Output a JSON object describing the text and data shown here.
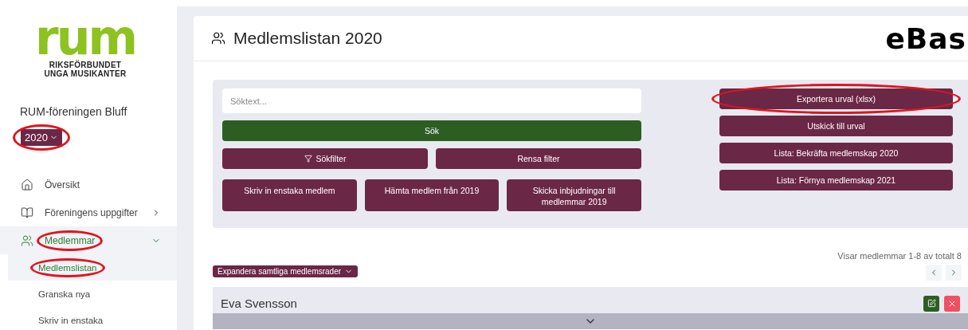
{
  "sidebar": {
    "logo_text": "rum",
    "logo_lines": [
      "RIKSFÖRBUNDET",
      "UNGA MUSIKANTER"
    ],
    "org_name": "RUM-föreningen Bluff",
    "year": {
      "label": "2020",
      "circled": true
    },
    "nav": [
      {
        "label": "Översikt",
        "selected": false,
        "circled": false
      },
      {
        "label": "Föreningens uppgifter",
        "selected": false,
        "expanded": false,
        "circled": false
      },
      {
        "label": "Medlemmar",
        "selected": true,
        "expanded": true,
        "circled": true,
        "children": [
          {
            "label": "Medlemslistan",
            "selected": true,
            "circled": true
          },
          {
            "label": "Granska nya",
            "selected": false,
            "circled": false
          },
          {
            "label": "Skriv in enstaka",
            "selected": false,
            "circled": false
          }
        ]
      }
    ]
  },
  "header": {
    "title": "Medlemslistan 2020",
    "brand": "eBas"
  },
  "search": {
    "placeholder": "Söktext..."
  },
  "search_button": "Sök",
  "filter_buttons": [
    {
      "label": "Sökfilter",
      "kind": "filter"
    },
    {
      "label": "Rensa filter",
      "kind": "plain"
    }
  ],
  "action_buttons": [
    "Skriv in enstaka medlem",
    "Hämta medlem från 2019",
    "Skicka inbjudningar till medlemmar 2019"
  ],
  "side_buttons": [
    {
      "label": "Exportera urval (xlsx)",
      "circled": true
    },
    {
      "label": "Utskick till urval",
      "circled": false
    },
    {
      "label": "Lista: Bekräfta medlemskap 2020",
      "circled": false
    },
    {
      "label": "Lista: Förnya medlemskap 2021",
      "circled": false
    }
  ],
  "expand_button": "Expandera samtliga medlemsrader",
  "count": "Visar medlemmar 1-8 av totalt 8",
  "members": [
    {
      "name": "Eva Svensson"
    }
  ]
}
